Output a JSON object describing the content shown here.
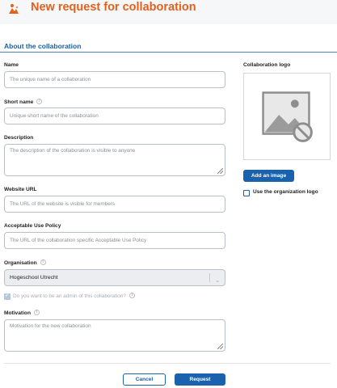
{
  "header": {
    "title": "New request for collaboration",
    "logo_icon": "orange-logo-icon"
  },
  "section": {
    "title": "About the collaboration"
  },
  "fields": {
    "name": {
      "label": "Name",
      "placeholder": "The unique name of a collaboration"
    },
    "short_name": {
      "label": "Short name",
      "placeholder": "Unique short name of the collaboration"
    },
    "description": {
      "label": "Description",
      "placeholder": "The description of the collaboration is visible to anyone"
    },
    "website": {
      "label": "Website URL",
      "placeholder": "The URL of the website is visible for members"
    },
    "aup": {
      "label": "Acceptable Use Policy",
      "placeholder": "The URL of the collaboration specific Acceptable Use Policy"
    },
    "organisation": {
      "label": "Organisation",
      "value": "Hogeschool Utrecht"
    },
    "admin": {
      "label": "Do you want to be an admin of this collaboration?",
      "checked": true,
      "disabled": true
    },
    "motivation": {
      "label": "Motivation",
      "placeholder": "Motivation for the new collaboration"
    }
  },
  "logo": {
    "label": "Collaboration logo",
    "add_button": "Add an image",
    "use_org_label": "Use the organization logo",
    "use_org_checked": false
  },
  "actions": {
    "cancel": "Cancel",
    "request": "Request"
  },
  "colors": {
    "accent": "#e2611d",
    "primary": "#1a62ad",
    "section": "#1a5fa0"
  }
}
